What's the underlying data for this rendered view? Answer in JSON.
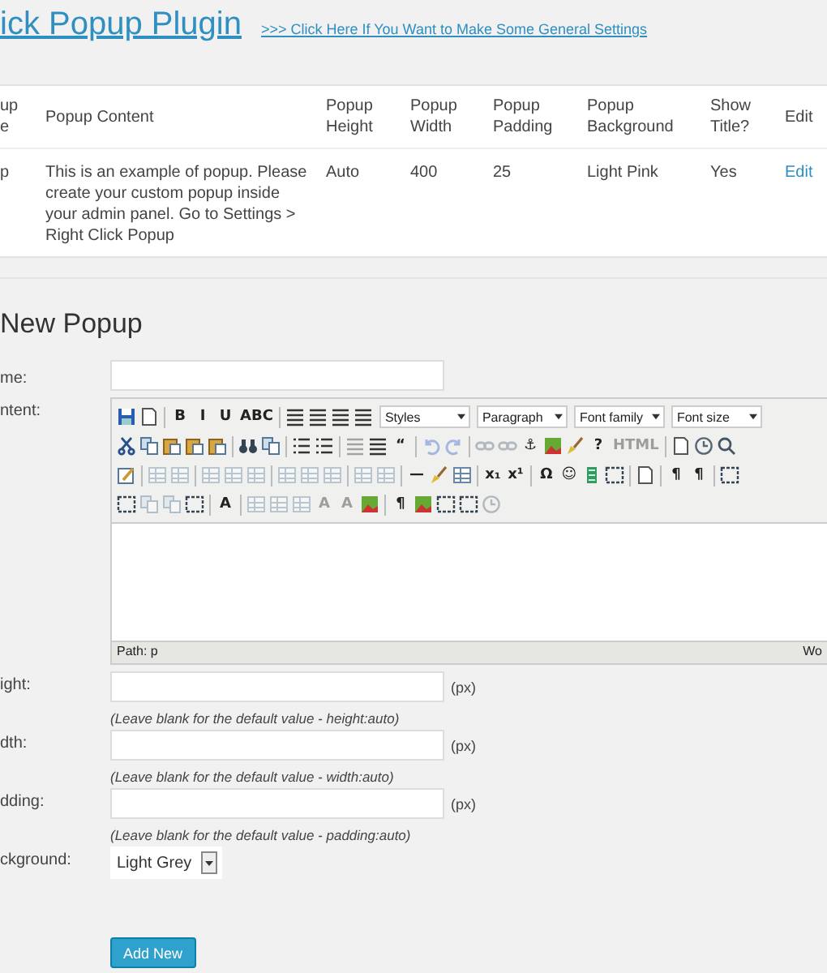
{
  "title": "ick Popup Plugin",
  "settings_link": ">>> Click Here If You Want to Make Some General Settings",
  "table": {
    "columns": [
      "up e",
      "Popup Content",
      "Popup Height",
      "Popup Width",
      "Popup Padding",
      "Popup Background",
      "Show Title?",
      "Edit"
    ],
    "rows": [
      {
        "cells": [
          "p",
          "This is an example of popup. Please create your custom popup inside your admin panel. Go to Settings > Right Click Popup",
          "Auto",
          "400",
          "25",
          "Light Pink",
          "Yes"
        ],
        "edit": "Edit"
      }
    ]
  },
  "form_title": "New Popup",
  "name_label": "me:",
  "content_label": "ntent:",
  "toolbar_rows": [
    [
      {
        "kind": "floppy",
        "disabled": false
      },
      {
        "kind": "page",
        "disabled": false
      },
      {
        "kind": "sep"
      },
      {
        "kind": "glyph",
        "text": "B",
        "disabled": false
      },
      {
        "kind": "glyph",
        "text": "I",
        "disabled": false
      },
      {
        "kind": "glyph",
        "text": "U",
        "disabled": false
      },
      {
        "kind": "glyph",
        "text": "ABC",
        "disabled": false
      },
      {
        "kind": "sep"
      },
      {
        "kind": "lines",
        "disabled": false
      },
      {
        "kind": "lines",
        "disabled": false
      },
      {
        "kind": "lines",
        "disabled": false
      },
      {
        "kind": "lines",
        "disabled": false
      },
      {
        "kind": "select",
        "text": "Styles"
      },
      {
        "kind": "select",
        "text": "Paragraph"
      },
      {
        "kind": "select",
        "text": "Font family"
      },
      {
        "kind": "select",
        "text": "Font size"
      }
    ],
    [
      {
        "kind": "scissors",
        "disabled": false
      },
      {
        "kind": "copy",
        "disabled": false
      },
      {
        "kind": "clipboard",
        "disabled": false
      },
      {
        "kind": "clipboard",
        "disabled": false
      },
      {
        "kind": "clipboard",
        "disabled": false
      },
      {
        "kind": "sep"
      },
      {
        "kind": "binoculars",
        "disabled": false
      },
      {
        "kind": "copy",
        "disabled": false
      },
      {
        "kind": "sep"
      },
      {
        "kind": "list",
        "disabled": false
      },
      {
        "kind": "list",
        "disabled": false
      },
      {
        "kind": "sep"
      },
      {
        "kind": "lines",
        "disabled": true
      },
      {
        "kind": "lines",
        "disabled": false
      },
      {
        "kind": "glyph",
        "text": "“",
        "disabled": false
      },
      {
        "kind": "sep"
      },
      {
        "kind": "undo",
        "disabled": true
      },
      {
        "kind": "redo",
        "disabled": true
      },
      {
        "kind": "sep"
      },
      {
        "kind": "link",
        "disabled": true
      },
      {
        "kind": "link",
        "disabled": true
      },
      {
        "kind": "glyph",
        "text": "⚓",
        "disabled": false
      },
      {
        "kind": "picture",
        "disabled": false
      },
      {
        "kind": "brush",
        "disabled": false
      },
      {
        "kind": "glyph",
        "text": "?",
        "disabled": false
      },
      {
        "kind": "glyph",
        "text": "HTML",
        "disabled": true
      },
      {
        "kind": "sep"
      },
      {
        "kind": "page",
        "disabled": false
      },
      {
        "kind": "clock",
        "disabled": false
      },
      {
        "kind": "magnifier",
        "disabled": false
      }
    ],
    [
      {
        "kind": "pencil",
        "disabled": false
      },
      {
        "kind": "sep"
      },
      {
        "kind": "grid",
        "disabled": true
      },
      {
        "kind": "grid",
        "disabled": true
      },
      {
        "kind": "sep"
      },
      {
        "kind": "grid",
        "disabled": true
      },
      {
        "kind": "grid",
        "disabled": true
      },
      {
        "kind": "grid",
        "disabled": true
      },
      {
        "kind": "sep"
      },
      {
        "kind": "grid",
        "disabled": true
      },
      {
        "kind": "grid",
        "disabled": true
      },
      {
        "kind": "grid",
        "disabled": true
      },
      {
        "kind": "sep"
      },
      {
        "kind": "grid",
        "disabled": true
      },
      {
        "kind": "grid",
        "disabled": true
      },
      {
        "kind": "sep"
      },
      {
        "kind": "glyph",
        "text": "—",
        "disabled": false
      },
      {
        "kind": "brush",
        "disabled": false
      },
      {
        "kind": "grid",
        "disabled": false
      },
      {
        "kind": "sep"
      },
      {
        "kind": "glyph",
        "text": "x₁",
        "disabled": false
      },
      {
        "kind": "glyph",
        "text": "x¹",
        "disabled": false
      },
      {
        "kind": "sep"
      },
      {
        "kind": "glyph",
        "text": "Ω",
        "disabled": false
      },
      {
        "kind": "glyph",
        "text": "☺",
        "disabled": false
      },
      {
        "kind": "film",
        "disabled": false
      },
      {
        "kind": "frame",
        "disabled": false
      },
      {
        "kind": "sep"
      },
      {
        "kind": "page",
        "disabled": false
      },
      {
        "kind": "sep"
      },
      {
        "kind": "glyph",
        "text": "¶",
        "disabled": false
      },
      {
        "kind": "glyph",
        "text": "¶",
        "disabled": false
      },
      {
        "kind": "sep"
      },
      {
        "kind": "frame",
        "disabled": false
      }
    ],
    [
      {
        "kind": "frame",
        "disabled": false
      },
      {
        "kind": "copy",
        "disabled": true
      },
      {
        "kind": "copy",
        "disabled": true
      },
      {
        "kind": "frame",
        "disabled": false
      },
      {
        "kind": "sep"
      },
      {
        "kind": "glyph",
        "text": "A",
        "disabled": false
      },
      {
        "kind": "sep"
      },
      {
        "kind": "grid",
        "disabled": true
      },
      {
        "kind": "grid",
        "disabled": true
      },
      {
        "kind": "grid",
        "disabled": true
      },
      {
        "kind": "glyph",
        "text": "A",
        "disabled": true
      },
      {
        "kind": "glyph",
        "text": "A",
        "disabled": true
      },
      {
        "kind": "picture",
        "disabled": false
      },
      {
        "kind": "sep"
      },
      {
        "kind": "glyph",
        "text": "¶",
        "disabled": false
      },
      {
        "kind": "picture",
        "disabled": false
      },
      {
        "kind": "frame",
        "disabled": false
      },
      {
        "kind": "frame",
        "disabled": false
      },
      {
        "kind": "clock",
        "disabled": true
      }
    ]
  ],
  "editor_path": "Path: p",
  "editor_status_right": "Wo",
  "dimension_fields": [
    {
      "label": "ight:",
      "unit": "(px)",
      "hint": "(Leave blank for the default value - height:auto)"
    },
    {
      "label": "dth:",
      "unit": "(px)",
      "hint": "(Leave blank for the default value - width:auto)"
    },
    {
      "label": "dding:",
      "unit": "(px)",
      "hint": "(Leave blank for the default value - padding:auto)"
    }
  ],
  "background": {
    "label": "ckground:",
    "value": "Light Grey"
  },
  "submit": "Add New"
}
